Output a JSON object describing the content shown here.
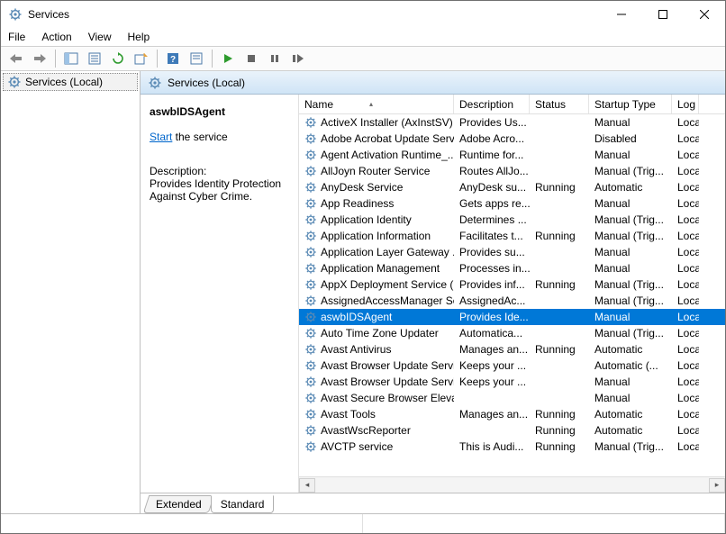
{
  "window": {
    "title": "Services"
  },
  "menu": {
    "file": "File",
    "action": "Action",
    "view": "View",
    "help": "Help"
  },
  "nav": {
    "root": "Services (Local)"
  },
  "header": {
    "label": "Services (Local)"
  },
  "detail": {
    "name": "aswbIDSAgent",
    "start_link": "Start",
    "start_suffix": " the service",
    "desc_label": "Description:",
    "desc_text": "Provides Identity Protection Against Cyber Crime."
  },
  "columns": {
    "name": "Name",
    "description": "Description",
    "status": "Status",
    "startup": "Startup Type",
    "logon": "Log"
  },
  "tabs": {
    "extended": "Extended",
    "standard": "Standard"
  },
  "services": [
    {
      "name": "ActiveX Installer (AxInstSV)",
      "desc": "Provides Us...",
      "status": "",
      "startup": "Manual",
      "logon": "Loca"
    },
    {
      "name": "Adobe Acrobat Update Serv...",
      "desc": "Adobe Acro...",
      "status": "",
      "startup": "Disabled",
      "logon": "Loca"
    },
    {
      "name": "Agent Activation Runtime_...",
      "desc": "Runtime for...",
      "status": "",
      "startup": "Manual",
      "logon": "Loca"
    },
    {
      "name": "AllJoyn Router Service",
      "desc": "Routes AllJo...",
      "status": "",
      "startup": "Manual (Trig...",
      "logon": "Loca"
    },
    {
      "name": "AnyDesk Service",
      "desc": "AnyDesk su...",
      "status": "Running",
      "startup": "Automatic",
      "logon": "Loca"
    },
    {
      "name": "App Readiness",
      "desc": "Gets apps re...",
      "status": "",
      "startup": "Manual",
      "logon": "Loca"
    },
    {
      "name": "Application Identity",
      "desc": "Determines ...",
      "status": "",
      "startup": "Manual (Trig...",
      "logon": "Loca"
    },
    {
      "name": "Application Information",
      "desc": "Facilitates t...",
      "status": "Running",
      "startup": "Manual (Trig...",
      "logon": "Loca"
    },
    {
      "name": "Application Layer Gateway ...",
      "desc": "Provides su...",
      "status": "",
      "startup": "Manual",
      "logon": "Loca"
    },
    {
      "name": "Application Management",
      "desc": "Processes in...",
      "status": "",
      "startup": "Manual",
      "logon": "Loca"
    },
    {
      "name": "AppX Deployment Service (...",
      "desc": "Provides inf...",
      "status": "Running",
      "startup": "Manual (Trig...",
      "logon": "Loca"
    },
    {
      "name": "AssignedAccessManager Se...",
      "desc": "AssignedAc...",
      "status": "",
      "startup": "Manual (Trig...",
      "logon": "Loca"
    },
    {
      "name": "aswbIDSAgent",
      "desc": "Provides Ide...",
      "status": "",
      "startup": "Manual",
      "logon": "Loca",
      "selected": true
    },
    {
      "name": "Auto Time Zone Updater",
      "desc": "Automatica...",
      "status": "",
      "startup": "Manual (Trig...",
      "logon": "Loca"
    },
    {
      "name": "Avast Antivirus",
      "desc": "Manages an...",
      "status": "Running",
      "startup": "Automatic",
      "logon": "Loca"
    },
    {
      "name": "Avast Browser Update Servi...",
      "desc": "Keeps your ...",
      "status": "",
      "startup": "Automatic (...",
      "logon": "Loca"
    },
    {
      "name": "Avast Browser Update Servi...",
      "desc": "Keeps your ...",
      "status": "",
      "startup": "Manual",
      "logon": "Loca"
    },
    {
      "name": "Avast Secure Browser Elevat...",
      "desc": "",
      "status": "",
      "startup": "Manual",
      "logon": "Loca"
    },
    {
      "name": "Avast Tools",
      "desc": "Manages an...",
      "status": "Running",
      "startup": "Automatic",
      "logon": "Loca"
    },
    {
      "name": "AvastWscReporter",
      "desc": "",
      "status": "Running",
      "startup": "Automatic",
      "logon": "Loca"
    },
    {
      "name": "AVCTP service",
      "desc": "This is Audi...",
      "status": "Running",
      "startup": "Manual (Trig...",
      "logon": "Loca"
    }
  ]
}
